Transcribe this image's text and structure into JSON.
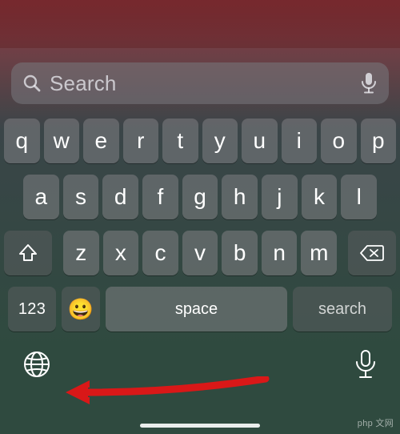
{
  "search": {
    "placeholder": "Search"
  },
  "keyboard": {
    "row1": [
      "q",
      "w",
      "e",
      "r",
      "t",
      "y",
      "u",
      "i",
      "o",
      "p"
    ],
    "row2": [
      "a",
      "s",
      "d",
      "f",
      "g",
      "h",
      "j",
      "k",
      "l"
    ],
    "row3": [
      "z",
      "x",
      "c",
      "v",
      "b",
      "n",
      "m"
    ],
    "numbers_label": "123",
    "emoji": "😀",
    "space_label": "space",
    "search_label": "search"
  },
  "watermark": "php  文网"
}
